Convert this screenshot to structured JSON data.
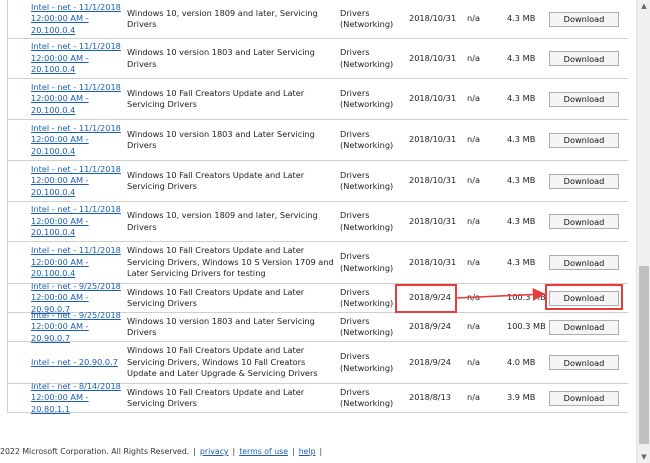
{
  "rows": [
    {
      "title": "Intel - net - 11/1/2018 12:00:00 AM - 20.100.0.4",
      "products": "Windows 10, version 1809 and later, Servicing Drivers",
      "classification": "Drivers (Networking)",
      "last_updated": "2018/10/31",
      "version": "n/a",
      "size": "4.3 MB",
      "button": "Download"
    },
    {
      "title": "Intel - net - 11/1/2018 12:00:00 AM - 20.100.0.4",
      "products": "Windows 10 version 1803 and Later Servicing Drivers",
      "classification": "Drivers (Networking)",
      "last_updated": "2018/10/31",
      "version": "n/a",
      "size": "4.3 MB",
      "button": "Download"
    },
    {
      "title": "Intel - net - 11/1/2018 12:00:00 AM - 20.100.0.4",
      "products": "Windows 10 Fall Creators Update and Later Servicing Drivers",
      "classification": "Drivers (Networking)",
      "last_updated": "2018/10/31",
      "version": "n/a",
      "size": "4.3 MB",
      "button": "Download"
    },
    {
      "title": "Intel - net - 11/1/2018 12:00:00 AM - 20.100.0.4",
      "products": "Windows 10 version 1803 and Later Servicing Drivers",
      "classification": "Drivers (Networking)",
      "last_updated": "2018/10/31",
      "version": "n/a",
      "size": "4.3 MB",
      "button": "Download"
    },
    {
      "title": "Intel - net - 11/1/2018 12:00:00 AM - 20.100.0.4",
      "products": "Windows 10 Fall Creators Update and Later Servicing Drivers",
      "classification": "Drivers (Networking)",
      "last_updated": "2018/10/31",
      "version": "n/a",
      "size": "4.3 MB",
      "button": "Download"
    },
    {
      "title": "Intel - net - 11/1/2018 12:00:00 AM - 20.100.0.4",
      "products": "Windows 10, version 1809 and later, Servicing Drivers",
      "classification": "Drivers (Networking)",
      "last_updated": "2018/10/31",
      "version": "n/a",
      "size": "4.3 MB",
      "button": "Download"
    },
    {
      "title": "Intel - net - 11/1/2018 12:00:00 AM - 20.100.0.4",
      "products": "Windows 10 Fall Creators Update and Later Servicing Drivers, Windows 10 S Version 1709 and Later Servicing Drivers for testing",
      "classification": "Drivers (Networking)",
      "last_updated": "2018/10/31",
      "version": "n/a",
      "size": "4.3 MB",
      "button": "Download"
    },
    {
      "title": "Intel - net - 9/25/2018 12:00:00 AM - 20.90.0.7",
      "products": "Windows 10 Fall Creators Update and Later Servicing Drivers",
      "classification": "Drivers (Networking)",
      "last_updated": "2018/9/24",
      "version": "n/a",
      "size": "100.3 MB",
      "button": "Download"
    },
    {
      "title": "Intel - net - 9/25/2018 12:00:00 AM - 20.90.0.7",
      "products": "Windows 10 version 1803 and Later Servicing Drivers",
      "classification": "Drivers (Networking)",
      "last_updated": "2018/9/24",
      "version": "n/a",
      "size": "100.3 MB",
      "button": "Download"
    },
    {
      "title": "Intel - net - 20.90.0.7",
      "products": "Windows 10 Fall Creators Update and Later Servicing Drivers, Windows 10 Fall Creators Update and Later Upgrade & Servicing Drivers",
      "classification": "Drivers (Networking)",
      "last_updated": "2018/9/24",
      "version": "n/a",
      "size": "4.0 MB",
      "button": "Download"
    },
    {
      "title": "Intel - net - 8/14/2018 12:00:00 AM - 20.80.1.1",
      "products": "Windows 10 Fall Creators Update and Later Servicing Drivers",
      "classification": "Drivers (Networking)",
      "last_updated": "2018/8/13",
      "version": "n/a",
      "size": "3.9 MB",
      "button": "Download"
    }
  ],
  "footer": {
    "copyright": "2022 Microsoft Corporation. All Rights Reserved.",
    "sep": "|",
    "links": [
      "privacy",
      "terms of use",
      "help"
    ]
  },
  "annotation": {
    "color": "#e83c3c"
  }
}
